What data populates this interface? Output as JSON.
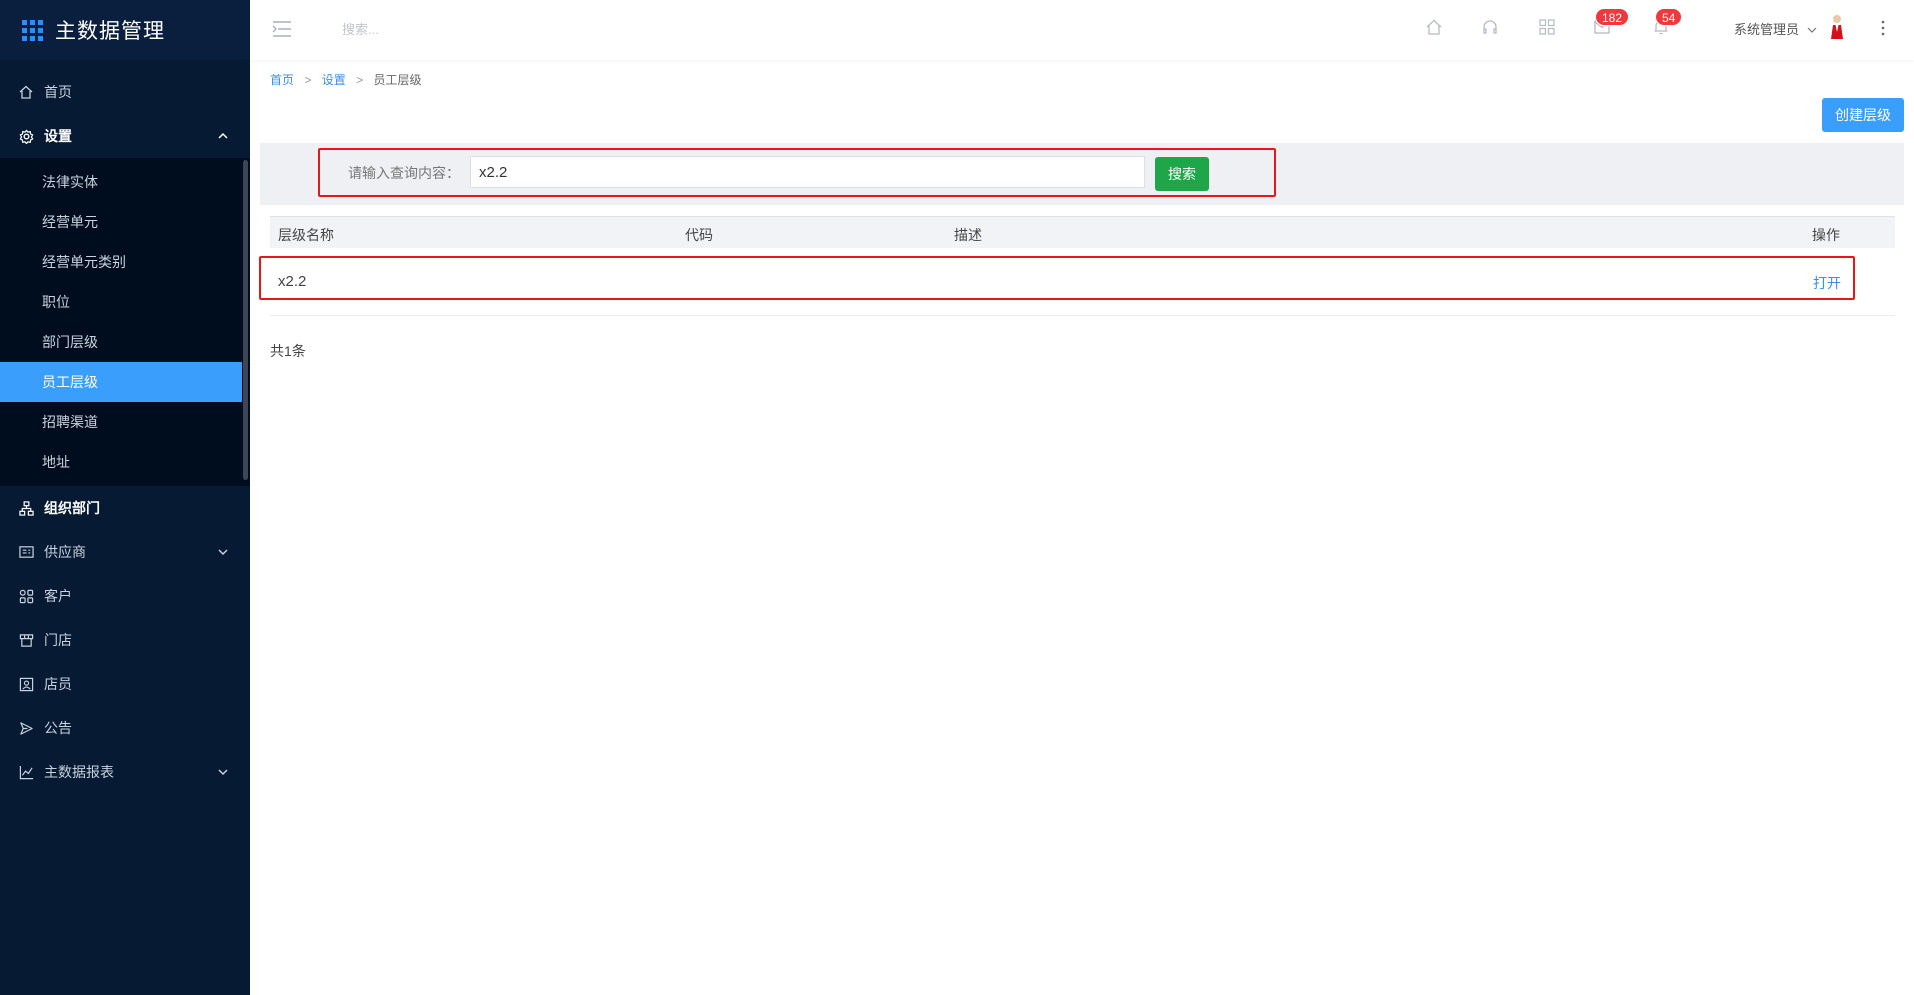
{
  "app": {
    "title": "主数据管理"
  },
  "sidebar": {
    "items": [
      {
        "label": "首页",
        "icon": "home-icon"
      },
      {
        "label": "设置",
        "icon": "gear-icon",
        "expanded": true,
        "children": [
          "法律实体",
          "经营单元",
          "经营单元类别",
          "职位",
          "部门层级",
          "员工层级",
          "招聘渠道",
          "地址"
        ],
        "active_child": "员工层级"
      },
      {
        "label": "组织部门",
        "icon": "org-tree-icon"
      },
      {
        "label": "供应商",
        "icon": "supplier-icon",
        "has_children": true
      },
      {
        "label": "客户",
        "icon": "customer-icon"
      },
      {
        "label": "门店",
        "icon": "store-icon"
      },
      {
        "label": "店员",
        "icon": "clerk-icon"
      },
      {
        "label": "公告",
        "icon": "announcement-icon"
      },
      {
        "label": "主数据报表",
        "icon": "chart-line-icon",
        "has_children": true
      }
    ]
  },
  "topbar": {
    "search_placeholder": "搜索...",
    "badges": {
      "messages": "182",
      "notifications": "54"
    },
    "user": "系统管理员"
  },
  "breadcrumb": [
    "首页",
    "设置",
    "员工层级"
  ],
  "actions": {
    "create_label": "创建层级"
  },
  "filter": {
    "label": "请输入查询内容：",
    "value": "x2.2",
    "search_label": "搜索"
  },
  "table": {
    "headers": [
      "层级名称",
      "代码",
      "描述",
      "操作"
    ],
    "rows": [
      {
        "name": "x2.2",
        "code": "",
        "desc": "",
        "action": "打开"
      }
    ],
    "total": "共1条"
  },
  "colors": {
    "sidebar_bg": "#061a33",
    "accent": "#3a9efc",
    "search_btn": "#1fa64a",
    "badge": "#f0383d",
    "highlight": "#e8161a"
  }
}
